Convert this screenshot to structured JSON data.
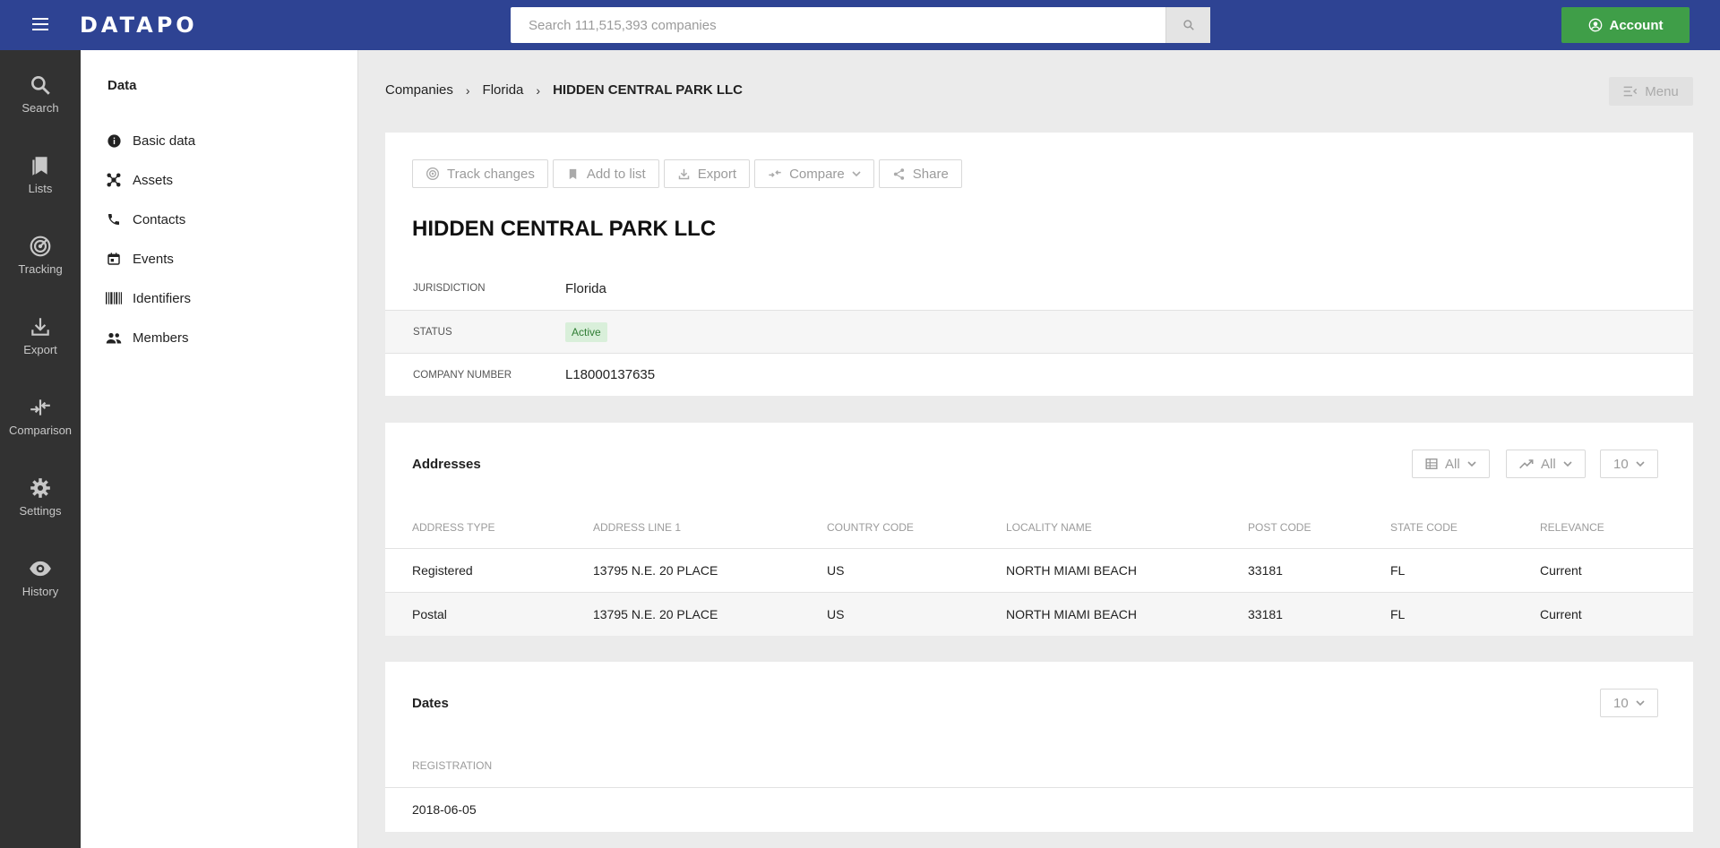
{
  "header": {
    "logo": "DATAPO",
    "search_placeholder": "Search 111,515,393 companies",
    "account_label": "Account"
  },
  "rail": [
    {
      "label": "Search",
      "icon": "search-icon"
    },
    {
      "label": "Lists",
      "icon": "bookmark-icon"
    },
    {
      "label": "Tracking",
      "icon": "radar-icon"
    },
    {
      "label": "Export",
      "icon": "download-icon"
    },
    {
      "label": "Comparison",
      "icon": "compare-icon"
    },
    {
      "label": "Settings",
      "icon": "gear-icon"
    },
    {
      "label": "History",
      "icon": "eye-icon"
    }
  ],
  "subnav": {
    "title": "Data",
    "items": [
      {
        "label": "Basic data",
        "icon": "info-icon"
      },
      {
        "label": "Assets",
        "icon": "hub-icon"
      },
      {
        "label": "Contacts",
        "icon": "phone-icon"
      },
      {
        "label": "Events",
        "icon": "calendar-icon"
      },
      {
        "label": "Identifiers",
        "icon": "barcode-icon"
      },
      {
        "label": "Members",
        "icon": "people-icon"
      }
    ]
  },
  "breadcrumb": [
    "Companies",
    "Florida",
    "HIDDEN CENTRAL PARK LLC"
  ],
  "menu_label": "Menu",
  "toolbar": {
    "track_changes": "Track changes",
    "add_to_list": "Add to list",
    "export": "Export",
    "compare": "Compare",
    "share": "Share"
  },
  "company": {
    "name": "HIDDEN CENTRAL PARK LLC",
    "fields": [
      {
        "label": "JURISDICTION",
        "value": "Florida"
      },
      {
        "label": "STATUS",
        "value": "Active"
      },
      {
        "label": "COMPANY NUMBER",
        "value": "L18000137635"
      }
    ]
  },
  "addresses": {
    "title": "Addresses",
    "filter1": "All",
    "filter2": "All",
    "page_size": "10",
    "columns": [
      "ADDRESS TYPE",
      "ADDRESS LINE 1",
      "COUNTRY CODE",
      "LOCALITY NAME",
      "POST CODE",
      "STATE CODE",
      "RELEVANCE"
    ],
    "rows": [
      [
        "Registered",
        "13795 N.E. 20 PLACE",
        "US",
        "NORTH MIAMI BEACH",
        "33181",
        "FL",
        "Current"
      ],
      [
        "Postal",
        "13795 N.E. 20 PLACE",
        "US",
        "NORTH MIAMI BEACH",
        "33181",
        "FL",
        "Current"
      ]
    ]
  },
  "dates": {
    "title": "Dates",
    "page_size": "10",
    "columns": [
      "REGISTRATION"
    ],
    "rows": [
      [
        "2018-06-05"
      ]
    ]
  }
}
